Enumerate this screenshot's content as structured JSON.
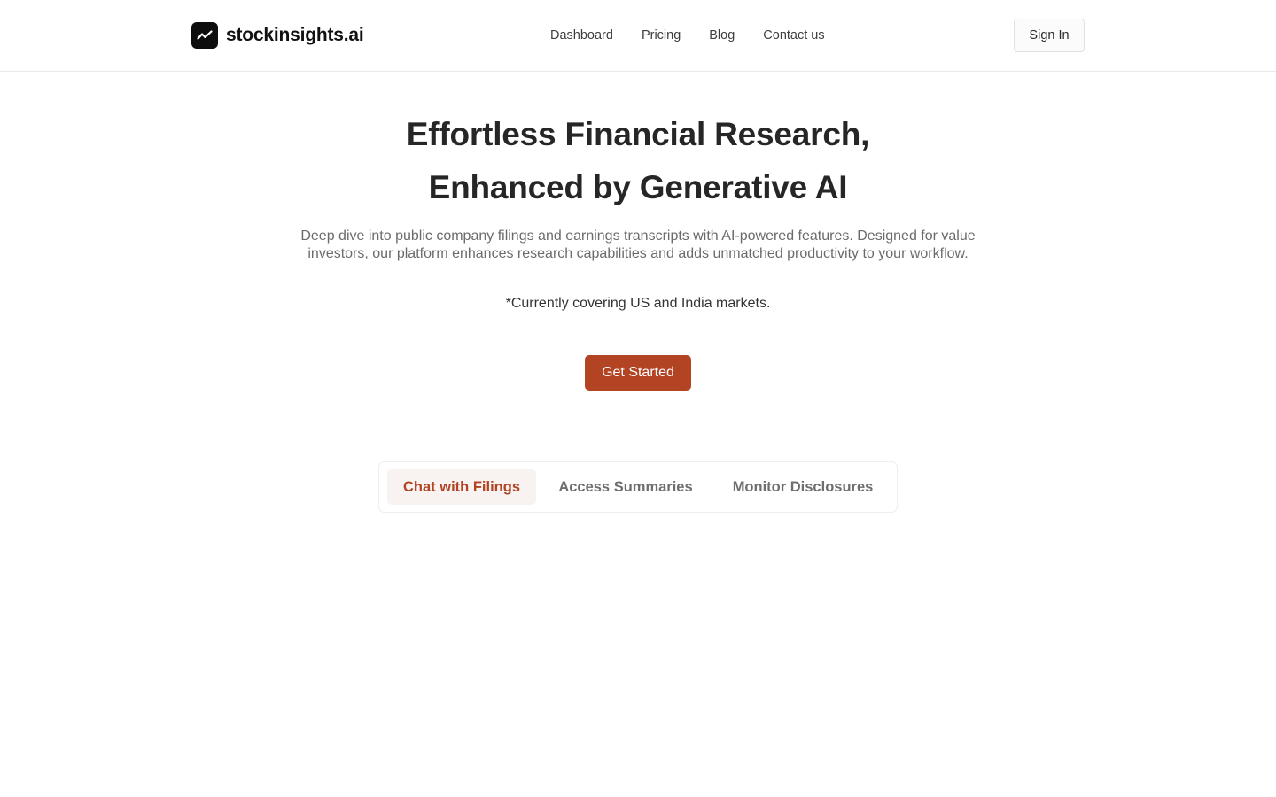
{
  "header": {
    "logo_text": "stockinsights.ai",
    "logo_icon": "trending-up-icon",
    "nav": [
      {
        "label": "Dashboard"
      },
      {
        "label": "Pricing"
      },
      {
        "label": "Blog"
      },
      {
        "label": "Contact us"
      }
    ],
    "signin_label": "Sign In"
  },
  "hero": {
    "title_line1": "Effortless Financial Research,",
    "title_line2": "Enhanced by Generative AI",
    "description": "Deep dive into public company filings and earnings transcripts with AI-powered features. Designed for value investors, our platform enhances research capabilities and adds unmatched productivity to your workflow.",
    "note": "*Currently covering US and India markets.",
    "cta_label": "Get Started"
  },
  "tabs": {
    "items": [
      {
        "label": "Chat with Filings",
        "active": true
      },
      {
        "label": "Access Summaries",
        "active": false
      },
      {
        "label": "Monitor Disclosures",
        "active": false
      }
    ]
  },
  "colors": {
    "accent": "#b24424",
    "active_tab_bg": "#f8f3f1"
  }
}
